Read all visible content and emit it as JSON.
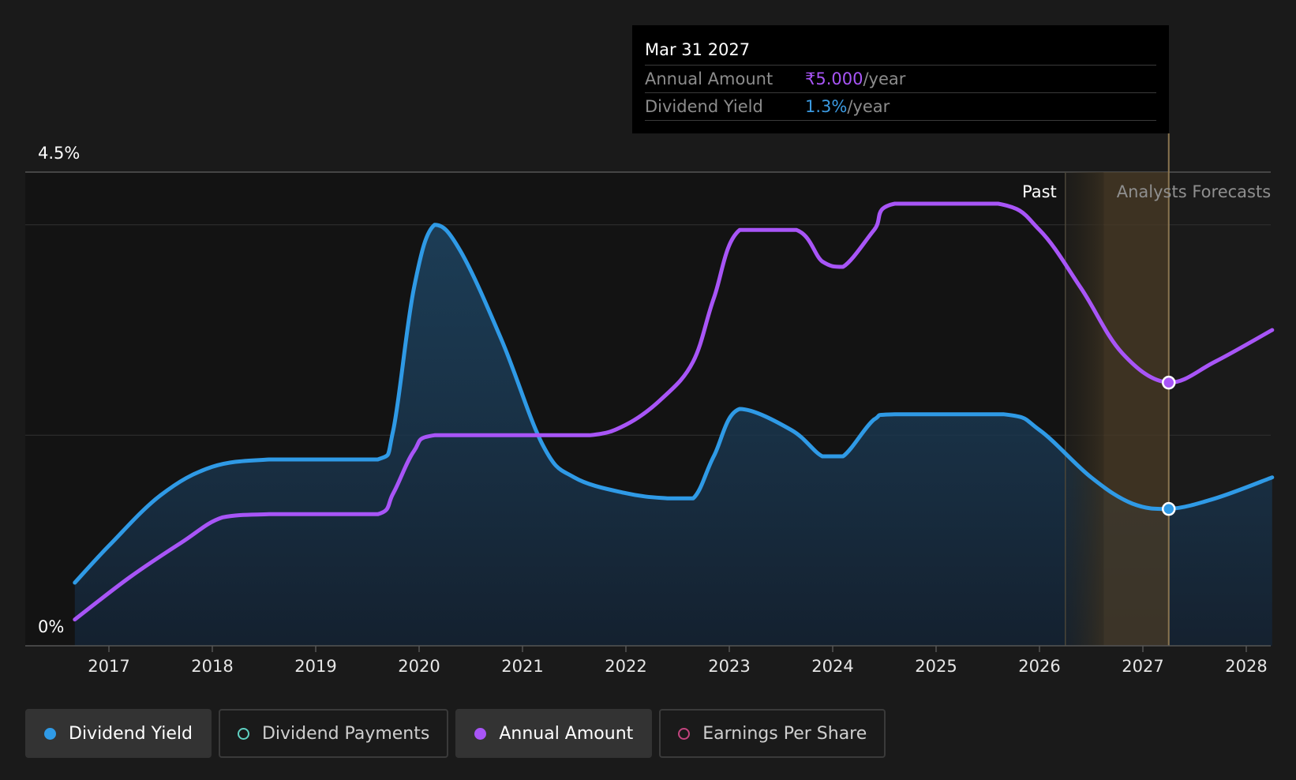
{
  "tooltip": {
    "date": "Mar 31 2027",
    "rows": [
      {
        "label": "Annual Amount",
        "value": "₹5.000",
        "unit": "/year"
      },
      {
        "label": "Dividend Yield",
        "value": "1.3%",
        "unit": "/year"
      }
    ]
  },
  "legend": [
    {
      "label": "Dividend Yield",
      "color": "#2f9ae6",
      "active": true,
      "hollow": false
    },
    {
      "label": "Dividend Payments",
      "color": "#5fd1c2",
      "active": false,
      "hollow": true
    },
    {
      "label": "Annual Amount",
      "color": "#a855f7",
      "active": true,
      "hollow": false
    },
    {
      "label": "Earnings Per Share",
      "color": "#c2447e",
      "active": false,
      "hollow": true
    }
  ],
  "colors": {
    "yield": "#2f9ae6",
    "amount": "#a855f7",
    "background": "#1a1a1a",
    "forecast_band": "#4a3b26"
  },
  "chart_data": {
    "type": "line",
    "y_tick_labels": [
      "4.5%",
      "0%"
    ],
    "ylim_yield_pct": [
      0,
      4.5
    ],
    "x_tick_labels": [
      "2017",
      "2018",
      "2019",
      "2020",
      "2021",
      "2022",
      "2023",
      "2024",
      "2025",
      "2026",
      "2027",
      "2028"
    ],
    "xlim": [
      2016.67,
      2028.25
    ],
    "region_labels": {
      "past": "Past",
      "forecast": "Analysts Forecasts"
    },
    "past_end": 2026.25,
    "forecast_start": 2026.62,
    "hover_x": 2027.25,
    "grid": true,
    "series": [
      {
        "name": "Dividend Yield",
        "key": "yield",
        "area": true,
        "points": [
          [
            2016.67,
            0.6
          ],
          [
            2017.0,
            0.95
          ],
          [
            2017.5,
            1.43
          ],
          [
            2018.0,
            1.7
          ],
          [
            2018.55,
            1.77
          ],
          [
            2019.0,
            1.77
          ],
          [
            2019.6,
            1.77
          ],
          [
            2019.75,
            2.05
          ],
          [
            2019.95,
            3.4
          ],
          [
            2020.15,
            4.0
          ],
          [
            2020.4,
            3.75
          ],
          [
            2020.8,
            2.9
          ],
          [
            2021.2,
            1.9
          ],
          [
            2021.5,
            1.6
          ],
          [
            2022.0,
            1.45
          ],
          [
            2022.4,
            1.4
          ],
          [
            2022.65,
            1.4
          ],
          [
            2022.85,
            1.8
          ],
          [
            2023.1,
            2.25
          ],
          [
            2023.6,
            2.05
          ],
          [
            2023.9,
            1.8
          ],
          [
            2024.1,
            1.8
          ],
          [
            2024.4,
            2.15
          ],
          [
            2024.6,
            2.2
          ],
          [
            2025.65,
            2.2
          ],
          [
            2026.0,
            2.05
          ],
          [
            2026.5,
            1.6
          ],
          [
            2026.9,
            1.35
          ],
          [
            2027.25,
            1.3
          ],
          [
            2027.7,
            1.4
          ],
          [
            2028.25,
            1.6
          ]
        ]
      },
      {
        "name": "Annual Amount",
        "key": "amount",
        "area": false,
        "points": [
          [
            2016.67,
            0.25
          ],
          [
            2017.2,
            0.65
          ],
          [
            2017.7,
            0.98
          ],
          [
            2018.1,
            1.22
          ],
          [
            2018.55,
            1.25
          ],
          [
            2019.0,
            1.25
          ],
          [
            2019.6,
            1.25
          ],
          [
            2019.75,
            1.45
          ],
          [
            2019.95,
            1.85
          ],
          [
            2020.15,
            2.0
          ],
          [
            2021.0,
            2.0
          ],
          [
            2021.65,
            2.0
          ],
          [
            2022.0,
            2.1
          ],
          [
            2022.35,
            2.35
          ],
          [
            2022.65,
            2.7
          ],
          [
            2022.85,
            3.3
          ],
          [
            2023.1,
            3.95
          ],
          [
            2023.65,
            3.95
          ],
          [
            2023.9,
            3.65
          ],
          [
            2024.1,
            3.6
          ],
          [
            2024.4,
            3.95
          ],
          [
            2024.6,
            4.2
          ],
          [
            2025.6,
            4.2
          ],
          [
            2026.0,
            3.95
          ],
          [
            2026.4,
            3.4
          ],
          [
            2026.8,
            2.78
          ],
          [
            2027.25,
            2.5
          ],
          [
            2027.7,
            2.7
          ],
          [
            2028.25,
            3.0
          ]
        ]
      }
    ]
  }
}
